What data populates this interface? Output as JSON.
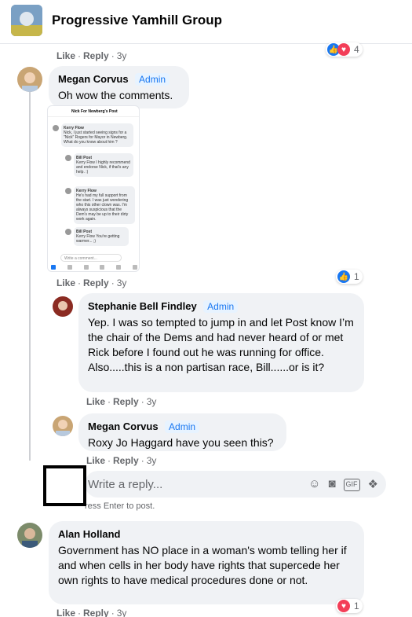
{
  "header": {
    "group_name": "Progressive Yamhill Group"
  },
  "actions": {
    "like": "Like",
    "reply": "Reply",
    "sep": "·"
  },
  "top_row": {
    "time": "3y",
    "reactions_count": "4"
  },
  "comment1": {
    "author": "Megan Corvus",
    "badge": "Admin",
    "text": "Oh wow the comments.",
    "time": "3y",
    "reactions_count": "1",
    "screenshot": {
      "title": "Nick For Newberg's Post",
      "items": [
        {
          "author": "Kerry Flow",
          "text": "Nick, I just started seeing signs for a \"Nick\" Rogers for Mayor in Newberg. What do you know about him ?"
        },
        {
          "author": "Bill Post",
          "text": "Kerry Flow I highly recommend and endorse Nick, if that's any help. :)"
        },
        {
          "author": "Kerry Flow",
          "text": "He's had my full support from the start. I was just wondering who this other clown was. I'm always suspicious that the Dem's may be up to their dirty work again."
        },
        {
          "author": "Bill Post",
          "text": "Kerry Flow You're getting warmer... ;)"
        }
      ],
      "compose": "Write a comment..."
    }
  },
  "reply1": {
    "author": "Stephanie Bell Findley",
    "badge": "Admin",
    "text": "Yep. I was so tempted to jump in and let Post know I’m the chair of the Dems and had never heard of or met Rick before I found out he was running for office. Also.....this is a non partisan race, Bill......or is it?",
    "time": "3y"
  },
  "reply2": {
    "author": "Megan Corvus",
    "badge": "Admin",
    "text": "Roxy Jo Haggard have you seen this?",
    "time": "3y"
  },
  "reply_box": {
    "placeholder": "Write a reply...",
    "hint": "ress Enter to post."
  },
  "comment2": {
    "author": "Alan Holland",
    "text": "Government has NO place in a woman's womb telling her if and when cells in her body have rights that supercede her own rights to have medical procedures done or not.",
    "time": "3y",
    "reactions_count": "1"
  },
  "icons": {
    "like": "thumbs-up-icon",
    "love": "heart-icon",
    "emoji": "smiley-icon",
    "camera": "camera-icon",
    "gif": "gif-icon",
    "sticker": "sticker-icon"
  }
}
